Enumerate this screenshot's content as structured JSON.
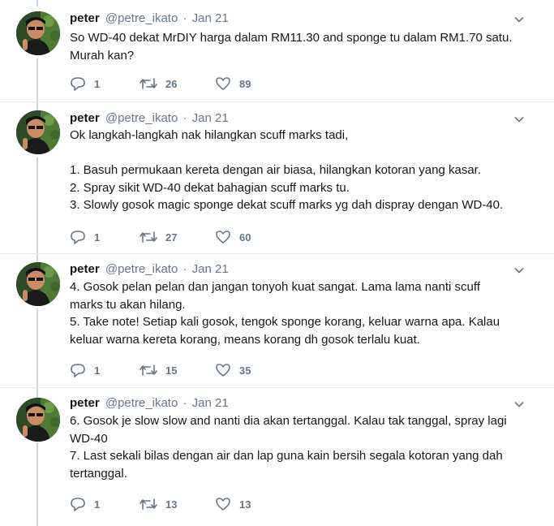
{
  "tweets": [
    {
      "name": "peter",
      "handle": "@petre_ikato",
      "separator": "·",
      "date": "Jan 21",
      "text": "So WD-40 dekat MrDIY harga dalam RM11.30 and sponge tu dalam RM1.70 satu.\nMurah kan?",
      "replies": "1",
      "retweets": "26",
      "likes": "89"
    },
    {
      "name": "peter",
      "handle": "@petre_ikato",
      "separator": "·",
      "date": "Jan 21",
      "text": "Ok langkah-langkah nak hilangkan scuff marks tadi,\n\n1. Basuh permukaan kereta dengan air biasa, hilangkan kotoran yang kasar.\n2. Spray sikit WD-40 dekat bahagian scuff marks tu.\n3. Slowly gosok magic sponge dekat scuff marks yg dah dispray dengan WD-40.",
      "replies": "1",
      "retweets": "27",
      "likes": "60"
    },
    {
      "name": "peter",
      "handle": "@petre_ikato",
      "separator": "·",
      "date": "Jan 21",
      "text": "4. Gosok pelan pelan dan jangan tonyoh kuat sangat. Lama lama nanti scuff\nmarks tu akan hilang.\n5. Take note! Setiap kali gosok, tengok sponge korang, keluar warna apa. Kalau\nkeluar warna kereta korang, means korang dh gosok terlalu kuat.",
      "replies": "1",
      "retweets": "15",
      "likes": "35"
    },
    {
      "name": "peter",
      "handle": "@petre_ikato",
      "separator": "·",
      "date": "Jan 21",
      "text": "6. Gosok je slow slow and nanti dia akan tertanggal. Kalau tak tanggal, spray lagi\nWD-40\n7. Last sekali bilas dengan air dan lap guna kain bersih segala kotoran yang dah\ntertanggal.",
      "replies": "1",
      "retweets": "13",
      "likes": "13"
    }
  ],
  "icons": {
    "reply": "reply-icon",
    "retweet": "retweet-icon",
    "like": "heart-icon",
    "menu": "chevron-down-icon"
  },
  "colors": {
    "text": "#14171a",
    "muted": "#657786",
    "divider": "#e6ecf0",
    "thread_line": "#ccd6dd"
  }
}
